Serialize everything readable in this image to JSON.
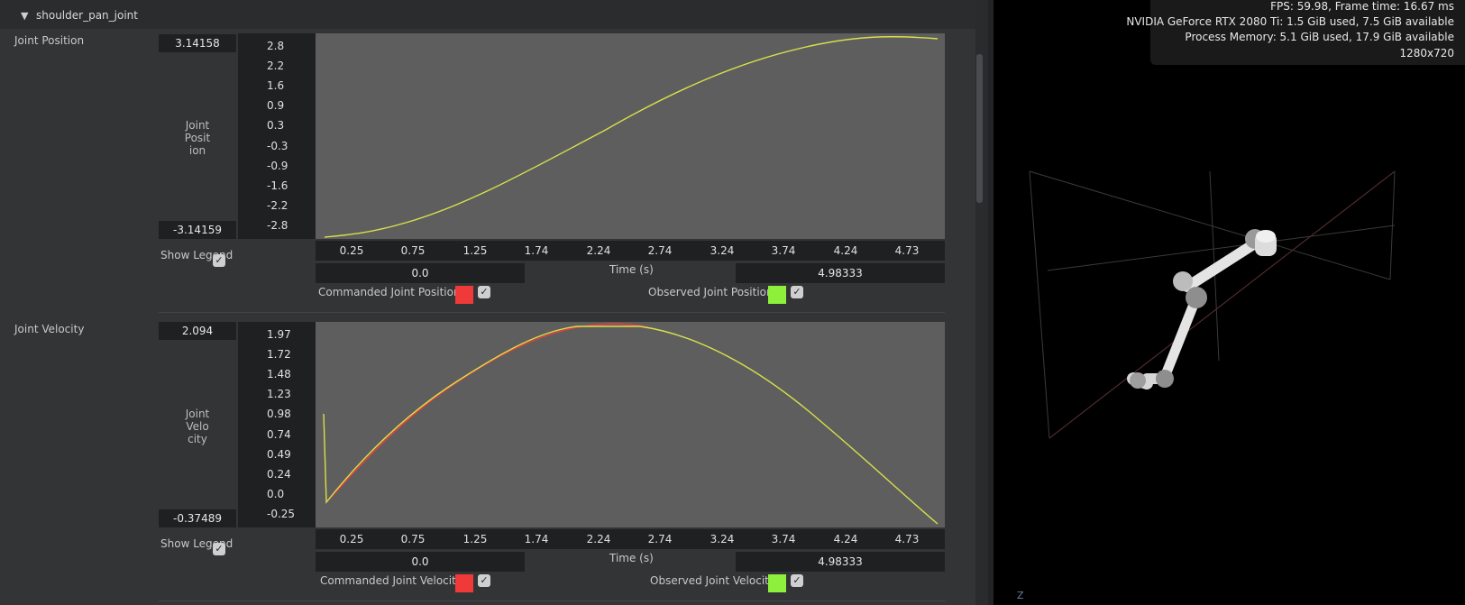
{
  "header": {
    "title": "shoulder_pan_joint"
  },
  "plots": [
    {
      "section_label": "Joint Position",
      "max_value": "3.14158",
      "min_value": "-3.14159",
      "y_label": "Joint\nPosit\nion",
      "y_ticks": [
        "2.8",
        "2.2",
        "1.6",
        "0.9",
        "0.3",
        "-0.3",
        "-0.9",
        "-1.6",
        "-2.2",
        "-2.8"
      ],
      "x_ticks": [
        "0.25",
        "0.75",
        "1.25",
        "1.74",
        "2.24",
        "2.74",
        "3.24",
        "3.74",
        "4.24",
        "4.73"
      ],
      "range_start": "0.0",
      "range_end": "4.98333",
      "x_label": "Time (s)",
      "show_legend": "Show\nLegend",
      "legend": [
        {
          "label": "Commanded Joint Position",
          "color": "#f03a3a"
        },
        {
          "label": "Observed Joint Position",
          "color": "#8ef03a"
        }
      ]
    },
    {
      "section_label": "Joint Velocity",
      "max_value": "2.094",
      "min_value": "-0.37489",
      "y_label": "Joint\nVelo\ncity",
      "y_ticks": [
        "1.97",
        "1.72",
        "1.48",
        "1.23",
        "0.98",
        "0.74",
        "0.49",
        "0.24",
        "0.0",
        "-0.25"
      ],
      "x_ticks": [
        "0.25",
        "0.75",
        "1.25",
        "1.74",
        "2.24",
        "2.74",
        "3.24",
        "3.74",
        "4.24",
        "4.73"
      ],
      "range_start": "0.0",
      "range_end": "4.98333",
      "x_label": "Time (s)",
      "show_legend": "Show\nLegend",
      "legend": [
        {
          "label": "Commanded Joint Velocity",
          "color": "#f03a3a"
        },
        {
          "label": "Observed Joint Velocity",
          "color": "#8ef03a"
        }
      ]
    }
  ],
  "stats": {
    "fps": "FPS: 59.98, Frame time: 16.67 ms",
    "gpu": "NVIDIA GeForce RTX 2080 Ti: 1.5 GiB used, 7.5 GiB available",
    "memory": "Process Memory: 5.1 GiB used, 17.9 GiB available",
    "resolution": "1280x720"
  },
  "viewport": {
    "axis_label": "Z"
  },
  "colors": {
    "curve": "#d8e04a",
    "plot_bg": "#5e5e5e"
  }
}
